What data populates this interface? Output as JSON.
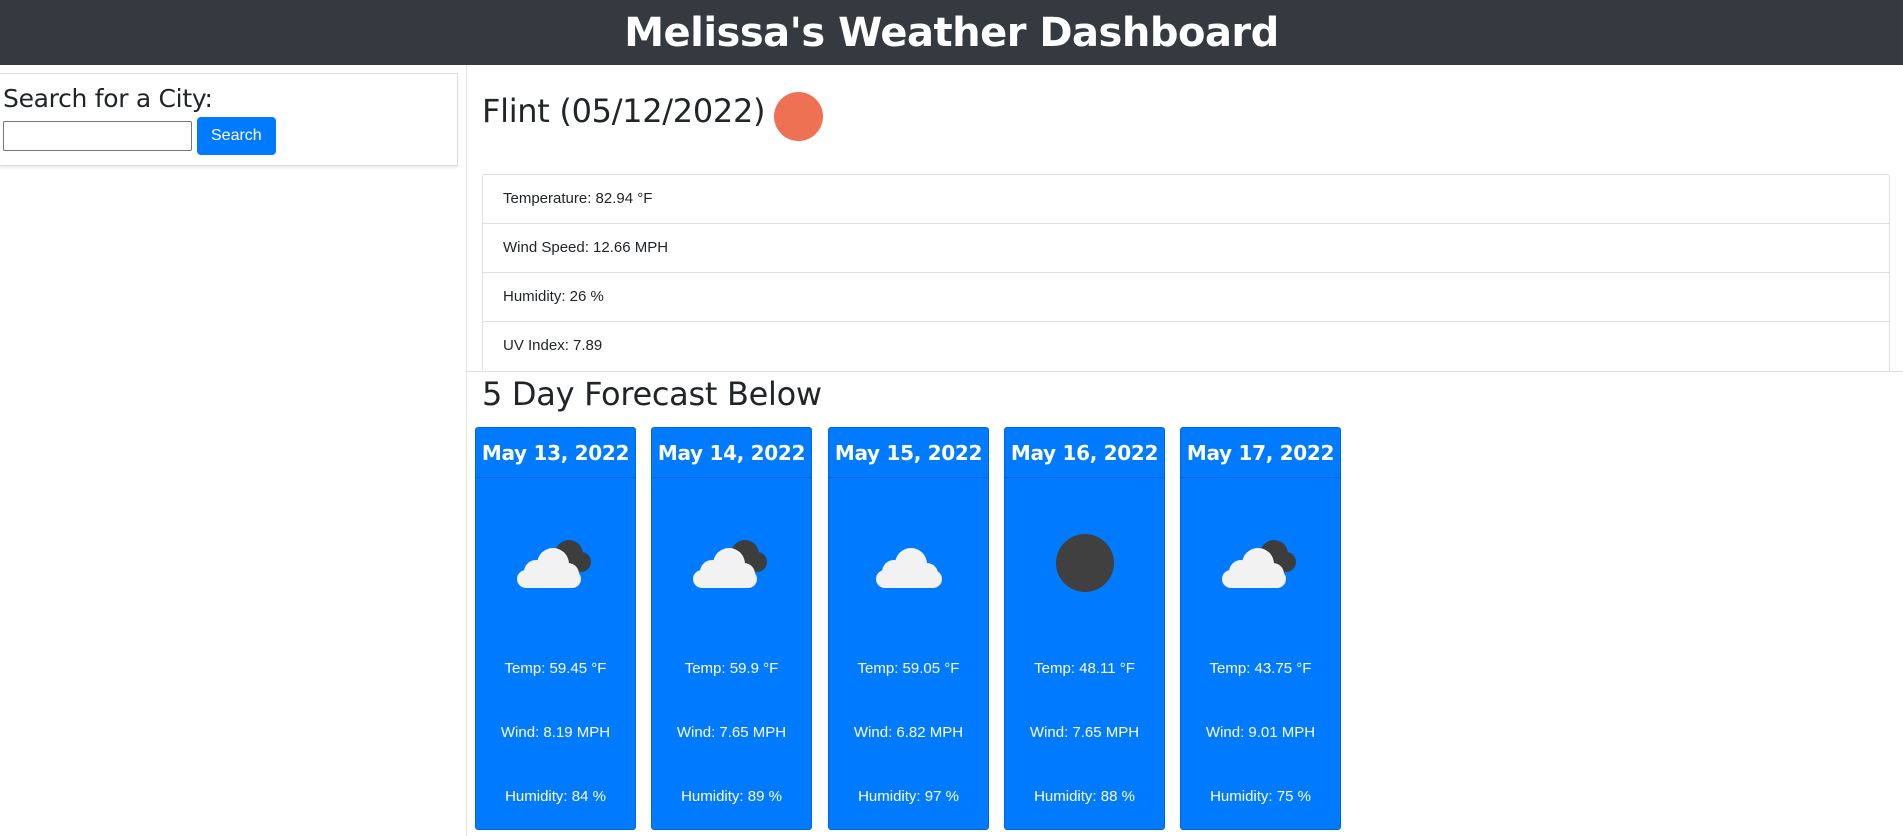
{
  "header": {
    "title": "Melissa's Weather Dashboard"
  },
  "search": {
    "heading": "Search for a City:",
    "input_value": "",
    "button_label": "Search"
  },
  "current": {
    "title": "Flint (05/12/2022)",
    "icon": "sun-icon",
    "icon_color": "#ef7153",
    "items": [
      {
        "label": "Temperature: 82.94 °F"
      },
      {
        "label": "Wind Speed: 12.66 MPH"
      },
      {
        "label": "Humidity: 26 %"
      },
      {
        "label": "UV Index: 7.89"
      }
    ]
  },
  "forecast": {
    "title": "5 Day Forecast Below",
    "accent_color": "#007bff",
    "days": [
      {
        "date": "May 13, 2022",
        "icon": "partly-cloudy-icon",
        "temp": "Temp: 59.45 °F",
        "wind": "Wind: 8.19 MPH",
        "humidity": "Humidity: 84 %"
      },
      {
        "date": "May 14, 2022",
        "icon": "partly-cloudy-icon",
        "temp": "Temp: 59.9 °F",
        "wind": "Wind: 7.65 MPH",
        "humidity": "Humidity: 89 %"
      },
      {
        "date": "May 15, 2022",
        "icon": "cloud-icon",
        "temp": "Temp: 59.05 °F",
        "wind": "Wind: 6.82 MPH",
        "humidity": "Humidity: 97 %"
      },
      {
        "date": "May 16, 2022",
        "icon": "dark-circle-icon",
        "temp": "Temp: 48.11 °F",
        "wind": "Wind: 7.65 MPH",
        "humidity": "Humidity: 88 %"
      },
      {
        "date": "May 17, 2022",
        "icon": "partly-cloudy-icon",
        "temp": "Temp: 43.75 °F",
        "wind": "Wind: 9.01 MPH",
        "humidity": "Humidity: 75 %"
      }
    ]
  }
}
